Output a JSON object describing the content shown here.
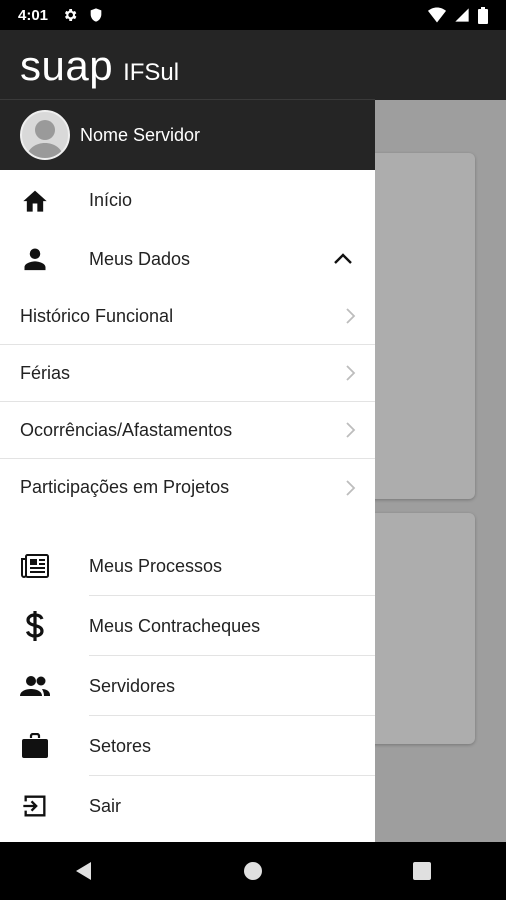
{
  "status_bar": {
    "time": "4:01",
    "icons": [
      "gear-icon",
      "shield-icon",
      "wifi-icon",
      "signal-icon",
      "battery-icon"
    ]
  },
  "drawer": {
    "brand": {
      "name": "suap",
      "org": "IFSul"
    },
    "user": {
      "name": "Nome Servidor"
    },
    "items": [
      {
        "label": "Início",
        "icon": "home-icon"
      },
      {
        "label": "Meus Dados",
        "icon": "person-icon",
        "expanded": true,
        "children": [
          {
            "label": "Histórico Funcional"
          },
          {
            "label": "Férias"
          },
          {
            "label": "Ocorrências/Afastamentos"
          },
          {
            "label": "Participações em Projetos"
          }
        ]
      },
      {
        "label": "Meus Processos",
        "icon": "newspaper-icon"
      },
      {
        "label": "Meus Contracheques",
        "icon": "dollar-icon"
      },
      {
        "label": "Servidores",
        "icon": "people-icon"
      },
      {
        "label": "Setores",
        "icon": "briefcase-icon"
      },
      {
        "label": "Sair",
        "icon": "logout-icon"
      }
    ]
  },
  "nav_bar": {
    "buttons": [
      "back-icon",
      "home-circle-icon",
      "recents-icon"
    ]
  },
  "colors": {
    "header": "#252525",
    "scrim": "#9e9e9e",
    "text": "#222222"
  }
}
